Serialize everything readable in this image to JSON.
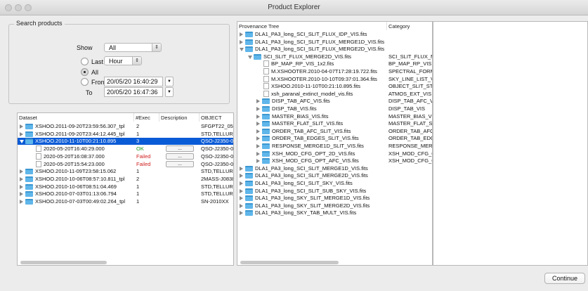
{
  "window": {
    "title": "Product Explorer"
  },
  "search": {
    "legend": "Search products",
    "show_label": "Show",
    "show_value": "All",
    "last_label": "Last",
    "last_unit": "Hour",
    "all_label": "All",
    "from_label": "From",
    "from_value": "20/05/20 16:40:29",
    "to_label": "To",
    "to_value": "20/05/20 16:47:36",
    "selected_radio": "All"
  },
  "datasets": {
    "headers": [
      "Dataset",
      "#Exec",
      "Description",
      "OBJECT"
    ],
    "rows": [
      {
        "name": "XSHOO.2011-09-20T23:59:56.307_tpl",
        "exec": "2",
        "desc": "",
        "object": "SFGPT22_05",
        "kind": "folder",
        "expanded": false,
        "selected": false
      },
      {
        "name": "XSHOO.2011-09-20T23:44:12.445_tpl",
        "exec": "1",
        "desc": "",
        "object": "STD,TELLURIC",
        "kind": "folder",
        "expanded": false,
        "selected": false
      },
      {
        "name": "XSHOO.2010-11-10T00:21:10.895",
        "exec": "3",
        "desc": "",
        "object": "QSO-J2350-0",
        "kind": "folder",
        "expanded": true,
        "selected": true
      },
      {
        "name": "2020-05-20T16:40:29.000",
        "exec": "OK",
        "desc": "...",
        "object": "QSO-J2350-0",
        "kind": "exec",
        "status": "ok"
      },
      {
        "name": "2020-05-20T16:08:37.000",
        "exec": "Failed",
        "desc": "...",
        "object": "QSO-J2350-0",
        "kind": "exec",
        "status": "fail"
      },
      {
        "name": "2020-05-20T15:54:23.000",
        "exec": "Failed",
        "desc": "...",
        "object": "QSO-J2350-0",
        "kind": "exec",
        "status": "fail"
      },
      {
        "name": "XSHOO.2010-11-09T23:58:15.062",
        "exec": "1",
        "desc": "",
        "object": "STD,TELLURIC",
        "kind": "folder",
        "expanded": false,
        "selected": false
      },
      {
        "name": "XSHOO.2010-10-06T08:57:10.811_tpl",
        "exec": "2",
        "desc": "",
        "object": "2MASS-J0838",
        "kind": "folder",
        "expanded": false,
        "selected": false
      },
      {
        "name": "XSHOO.2010-10-06T08:51:04.469",
        "exec": "1",
        "desc": "",
        "object": "STD,TELLURIC",
        "kind": "folder",
        "expanded": false,
        "selected": false
      },
      {
        "name": "XSHOO.2010-07-03T01:13:06.794",
        "exec": "1",
        "desc": "",
        "object": "STD,TELLURIC",
        "kind": "folder",
        "expanded": false,
        "selected": false
      },
      {
        "name": "XSHOO.2010-07-03T00:49:02.264_tpl",
        "exec": "1",
        "desc": "",
        "object": "SN-2010XX",
        "kind": "folder",
        "expanded": false,
        "selected": false
      }
    ]
  },
  "provenance": {
    "headers": [
      "Provenance Tree",
      "Category"
    ],
    "rows": [
      {
        "level": 0,
        "kind": "folder",
        "state": "closed",
        "name": "DLA1_PA3_long_SCI_SLIT_FLUX_IDP_VIS.fits",
        "category": ""
      },
      {
        "level": 0,
        "kind": "folder",
        "state": "closed",
        "name": "DLA1_PA3_long_SCI_SLIT_FLUX_MERGE1D_VIS.fits",
        "category": ""
      },
      {
        "level": 0,
        "kind": "folder",
        "state": "open",
        "name": "DLA1_PA3_long_SCI_SLIT_FLUX_MERGE2D_VIS.fits",
        "category": ""
      },
      {
        "level": 1,
        "kind": "folder",
        "state": "open",
        "name": "SCI_SLIT_FLUX_MERGE2D_VIS.fits",
        "category": "SCI_SLIT_FLUX_MEI"
      },
      {
        "level": 2,
        "kind": "file",
        "state": "none",
        "name": "BP_MAP_RP_VIS_1x2.fits",
        "category": "BP_MAP_RP_VIS"
      },
      {
        "level": 2,
        "kind": "file",
        "state": "none",
        "name": "M.XSHOOTER.2010-04-07T17:28:19.722.fits",
        "category": "SPECTRAL_FORMA"
      },
      {
        "level": 2,
        "kind": "file",
        "state": "none",
        "name": "M.XSHOOTER.2010-10-10T09:37:01.364.fits",
        "category": "SKY_LINE_LIST_VIS"
      },
      {
        "level": 2,
        "kind": "file",
        "state": "none",
        "name": "XSHOO.2010-11-10T00:21:10.895.fits",
        "category": "OBJECT_SLIT_STAR"
      },
      {
        "level": 2,
        "kind": "file",
        "state": "none",
        "name": "xsh_paranal_extinct_model_vis.fits",
        "category": "ATMOS_EXT_VIS"
      },
      {
        "level": 2,
        "kind": "folder",
        "state": "closed",
        "name": "DISP_TAB_AFC_VIS.fits",
        "category": "DISP_TAB_AFC_VIS"
      },
      {
        "level": 2,
        "kind": "folder",
        "state": "closed",
        "name": "DISP_TAB_VIS.fits",
        "category": "DISP_TAB_VIS"
      },
      {
        "level": 2,
        "kind": "folder",
        "state": "closed",
        "name": "MASTER_BIAS_VIS.fits",
        "category": "MASTER_BIAS_VIS"
      },
      {
        "level": 2,
        "kind": "folder",
        "state": "closed",
        "name": "MASTER_FLAT_SLIT_VIS.fits",
        "category": "MASTER_FLAT_SLIT"
      },
      {
        "level": 2,
        "kind": "folder",
        "state": "closed",
        "name": "ORDER_TAB_AFC_SLIT_VIS.fits",
        "category": "ORDER_TAB_AFC_"
      },
      {
        "level": 2,
        "kind": "folder",
        "state": "closed",
        "name": "ORDER_TAB_EDGES_SLIT_VIS.fits",
        "category": "ORDER_TAB_EDGE"
      },
      {
        "level": 2,
        "kind": "folder",
        "state": "closed",
        "name": "RESPONSE_MERGE1D_SLIT_VIS.fits",
        "category": "RESPONSE_MERGE"
      },
      {
        "level": 2,
        "kind": "folder",
        "state": "closed",
        "name": "XSH_MOD_CFG_OPT_2D_VIS.fits",
        "category": "XSH_MOD_CFG_OF"
      },
      {
        "level": 2,
        "kind": "folder",
        "state": "closed",
        "name": "XSH_MOD_CFG_OPT_AFC_VIS.fits",
        "category": "XSH_MOD_CFG_OF"
      },
      {
        "level": 0,
        "kind": "folder",
        "state": "closed",
        "name": "DLA1_PA3_long_SCI_SLIT_MERGE1D_VIS.fits",
        "category": ""
      },
      {
        "level": 0,
        "kind": "folder",
        "state": "closed",
        "name": "DLA1_PA3_long_SCI_SLIT_MERGE2D_VIS.fits",
        "category": ""
      },
      {
        "level": 0,
        "kind": "folder",
        "state": "closed",
        "name": "DLA1_PA3_long_SCI_SLIT_SKY_VIS.fits",
        "category": ""
      },
      {
        "level": 0,
        "kind": "folder",
        "state": "closed",
        "name": "DLA1_PA3_long_SCI_SLIT_SUB_SKY_VIS.fits",
        "category": ""
      },
      {
        "level": 0,
        "kind": "folder",
        "state": "closed",
        "name": "DLA1_PA3_long_SKY_SLIT_MERGE1D_VIS.fits",
        "category": ""
      },
      {
        "level": 0,
        "kind": "folder",
        "state": "closed",
        "name": "DLA1_PA3_long_SKY_SLIT_MERGE2D_VIS.fits",
        "category": ""
      },
      {
        "level": 0,
        "kind": "folder",
        "state": "closed",
        "name": "DLA1_PA3_long_SKY_TAB_MULT_VIS.fits",
        "category": ""
      }
    ]
  },
  "footer": {
    "continue_label": "Continue"
  }
}
